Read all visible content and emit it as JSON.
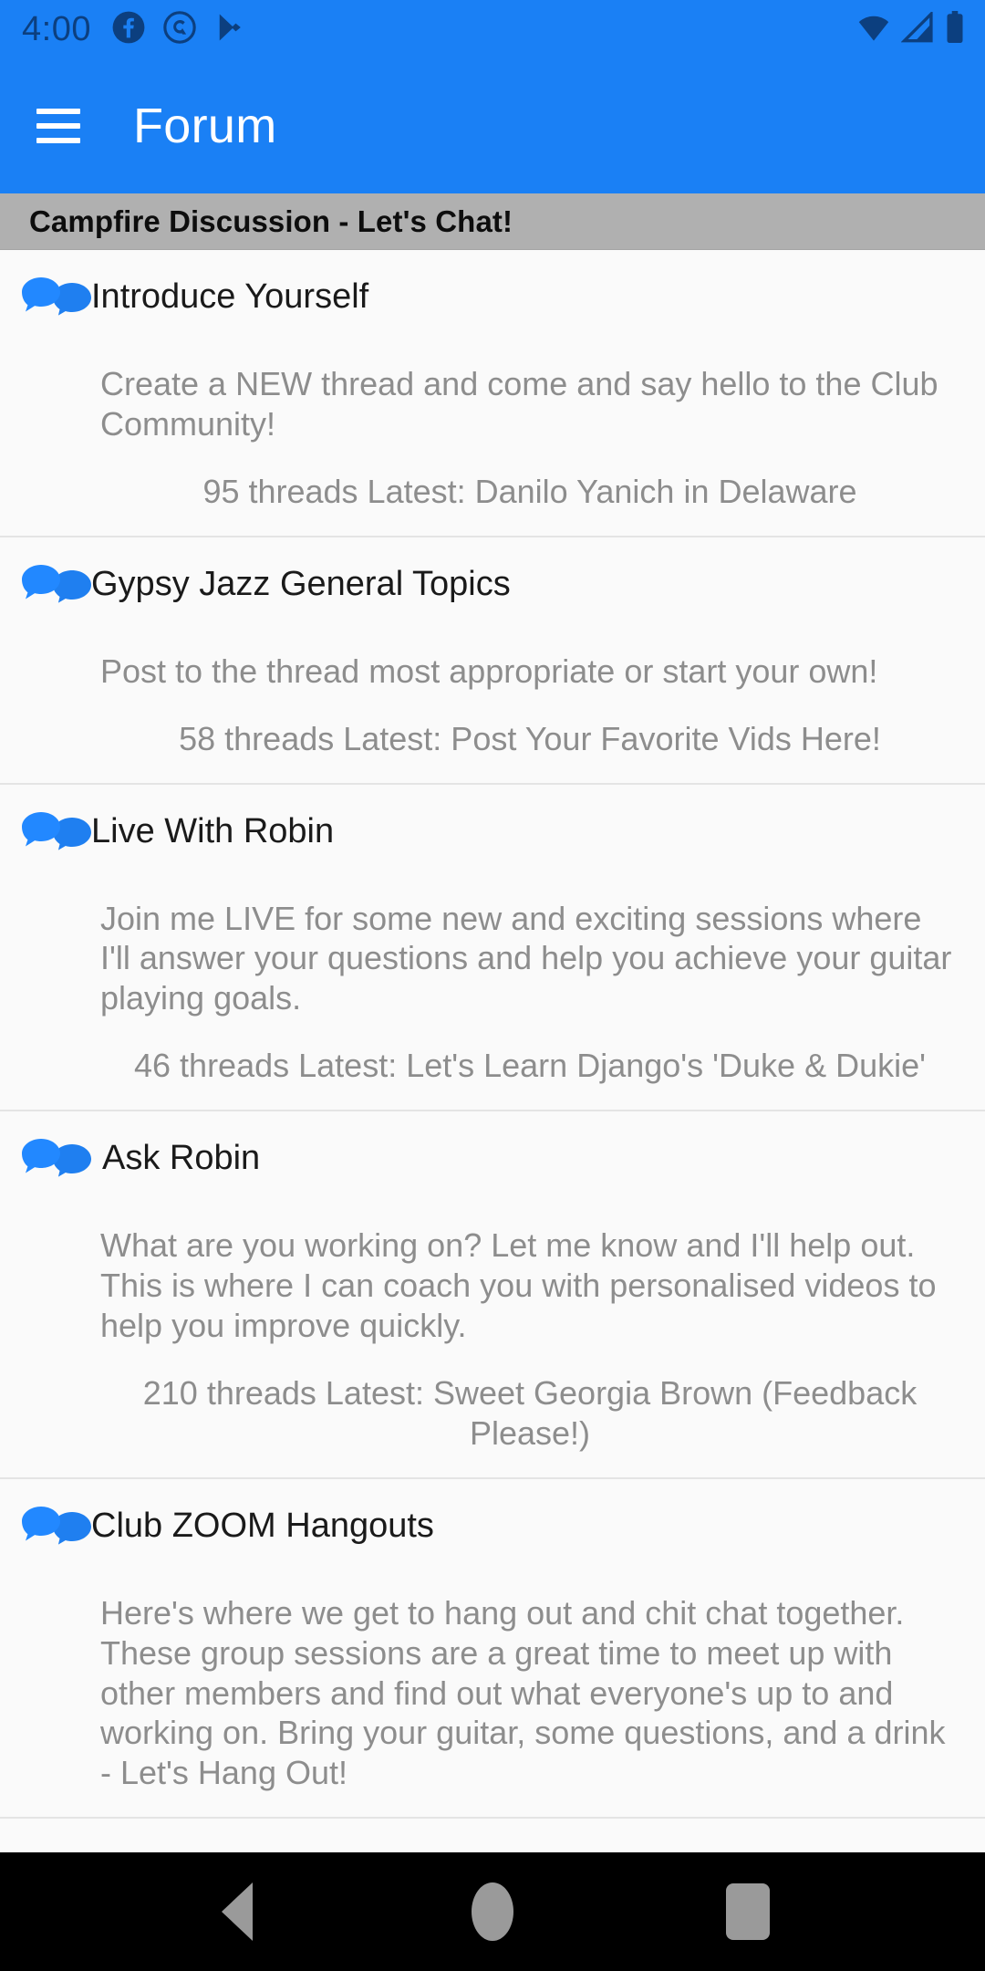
{
  "status_bar": {
    "time": "4:00",
    "left_icons": [
      "facebook-icon",
      "privacy-shield-icon",
      "play-store-icon"
    ],
    "right_icons": [
      "wifi-icon",
      "cellular-signal-icon",
      "battery-icon"
    ],
    "background_color": "#1a80f5",
    "icon_color": "#0c3f7f"
  },
  "app_bar": {
    "menu_icon": "hamburger-menu-icon",
    "title": "Forum",
    "background_color": "#1a80f5",
    "text_color": "#ffffff"
  },
  "section": {
    "header": "Campfire Discussion - Let's Chat!",
    "background_color": "#b0b0b0"
  },
  "forums": [
    {
      "icon": "chat-bubbles-icon",
      "title": "Introduce Yourself",
      "description": "Create a NEW thread and come and say hello to the Club Community!",
      "meta": "95 threads  Latest: Danilo Yanich in Delaware",
      "threads": "95 threads",
      "latest": "Latest: Danilo Yanich in Delaware"
    },
    {
      "icon": "chat-bubbles-icon",
      "title": "Gypsy Jazz General Topics",
      "description": "Post to the thread most appropriate or start your own!",
      "meta": "58 threads  Latest: Post Your Favorite Vids Here!",
      "threads": "58 threads",
      "latest": "Latest: Post Your Favorite Vids Here!"
    },
    {
      "icon": "chat-bubbles-icon",
      "title": "Live With Robin",
      "description": "Join me LIVE for some new and exciting sessions where I'll answer your questions and help you achieve your guitar playing goals.",
      "meta": "46 threads  Latest: Let's Learn Django's 'Duke & Dukie'",
      "threads": "46 threads",
      "latest": "Latest: Let's Learn Django's 'Duke & Dukie'"
    },
    {
      "icon": "chat-bubbles-icon",
      "title": "Ask Robin",
      "description": "What are you working on? Let me know and I'll help out. This is where I can coach you with personalised videos to help you improve quickly.",
      "meta": "210 threads  Latest: Sweet Georgia Brown (Feedback Please!)",
      "threads": "210 threads",
      "latest": "Latest: Sweet Georgia Brown (Feedback Please!)"
    },
    {
      "icon": "chat-bubbles-icon",
      "title": "Club ZOOM Hangouts",
      "description": "Here's where we get to hang out and chit chat together. These group sessions are a great time to meet up with other members and find out what everyone's up to and working on.   Bring your guitar, some questions, and a drink - Let's Hang Out!",
      "meta": "",
      "threads": "",
      "latest": ""
    }
  ],
  "nav_bar": {
    "back_label": "back-button",
    "home_label": "home-button",
    "recents_label": "recents-button",
    "background_color": "#000000",
    "icon_color": "#9a9a9a"
  },
  "colors": {
    "accent": "#1a80f5",
    "list_background": "#fafafa",
    "muted_text": "#8d8d8d",
    "divider": "#e4e4e4"
  }
}
